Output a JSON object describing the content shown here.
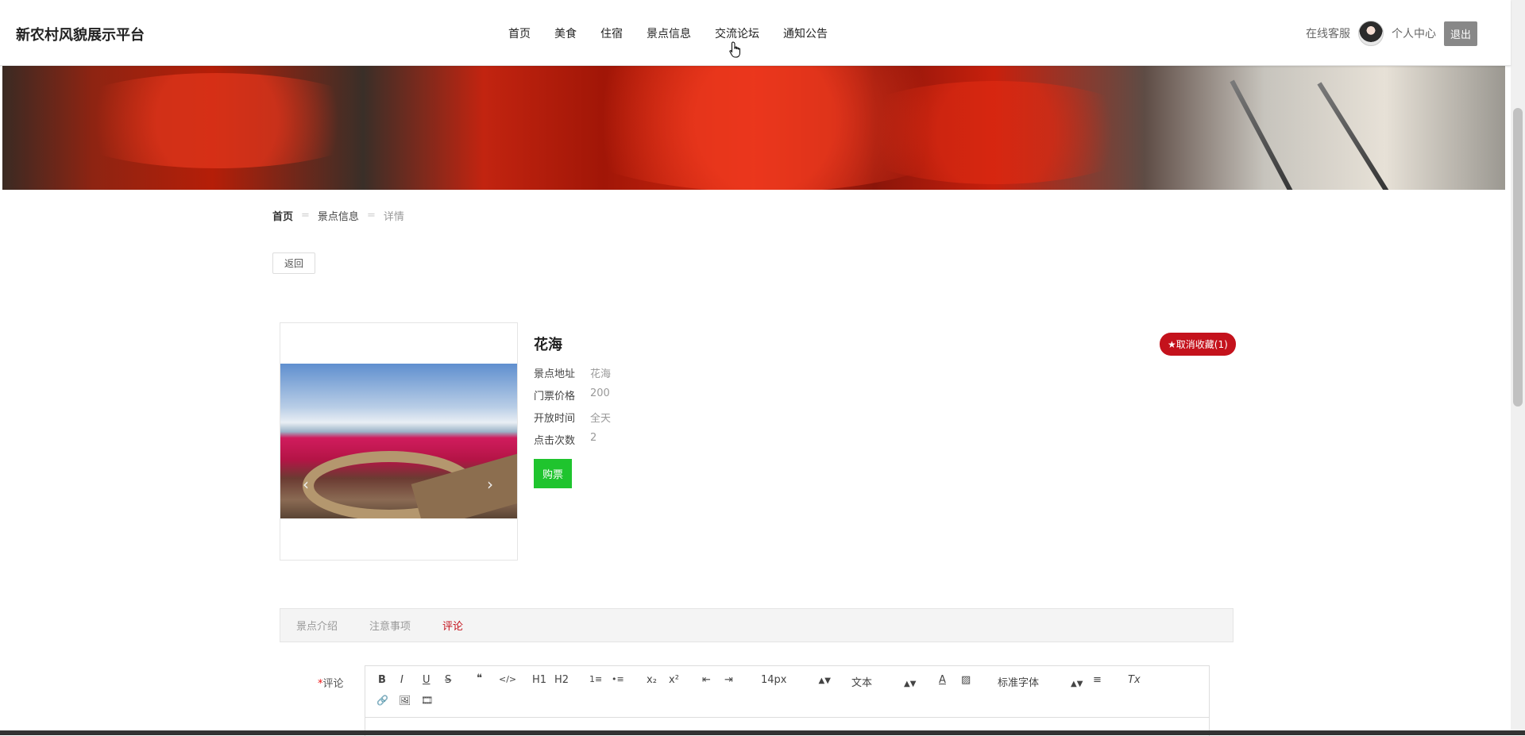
{
  "app": {
    "brand": "新农村风貌展示平台"
  },
  "nav": [
    "首页",
    "美食",
    "住宿",
    "景点信息",
    "交流论坛",
    "通知公告"
  ],
  "header_right": {
    "service": "在线客服",
    "profile": "个人中心",
    "logout": "退出"
  },
  "breadcrumb": {
    "home": "首页",
    "section": "景点信息",
    "current": "详情"
  },
  "back_label": "返回",
  "spot": {
    "title": "花海",
    "fields": [
      {
        "label": "景点地址",
        "value": "花海"
      },
      {
        "label": "门票价格",
        "value": "200"
      },
      {
        "label": "开放时间",
        "value": "全天"
      },
      {
        "label": "点击次数",
        "value": "2"
      }
    ],
    "buy_label": "购票",
    "favorite_label": "★取消收藏(1)"
  },
  "tabs": [
    "景点介绍",
    "注意事项",
    "评论"
  ],
  "active_tab": "评论",
  "comment": {
    "required_mark": "*",
    "label": "评论"
  },
  "editor": {
    "font_size": "14px",
    "format": "文本",
    "font": "标准字体",
    "buttons": [
      "B",
      "I",
      "U",
      "S",
      "❝",
      "</>",
      "H1",
      "H2",
      "1≡",
      "•≡",
      "x₂",
      "x²",
      "⇤",
      "⇥",
      "A",
      "▨",
      "≡",
      "Tx",
      "🔗",
      "🖼",
      "🎞"
    ]
  }
}
